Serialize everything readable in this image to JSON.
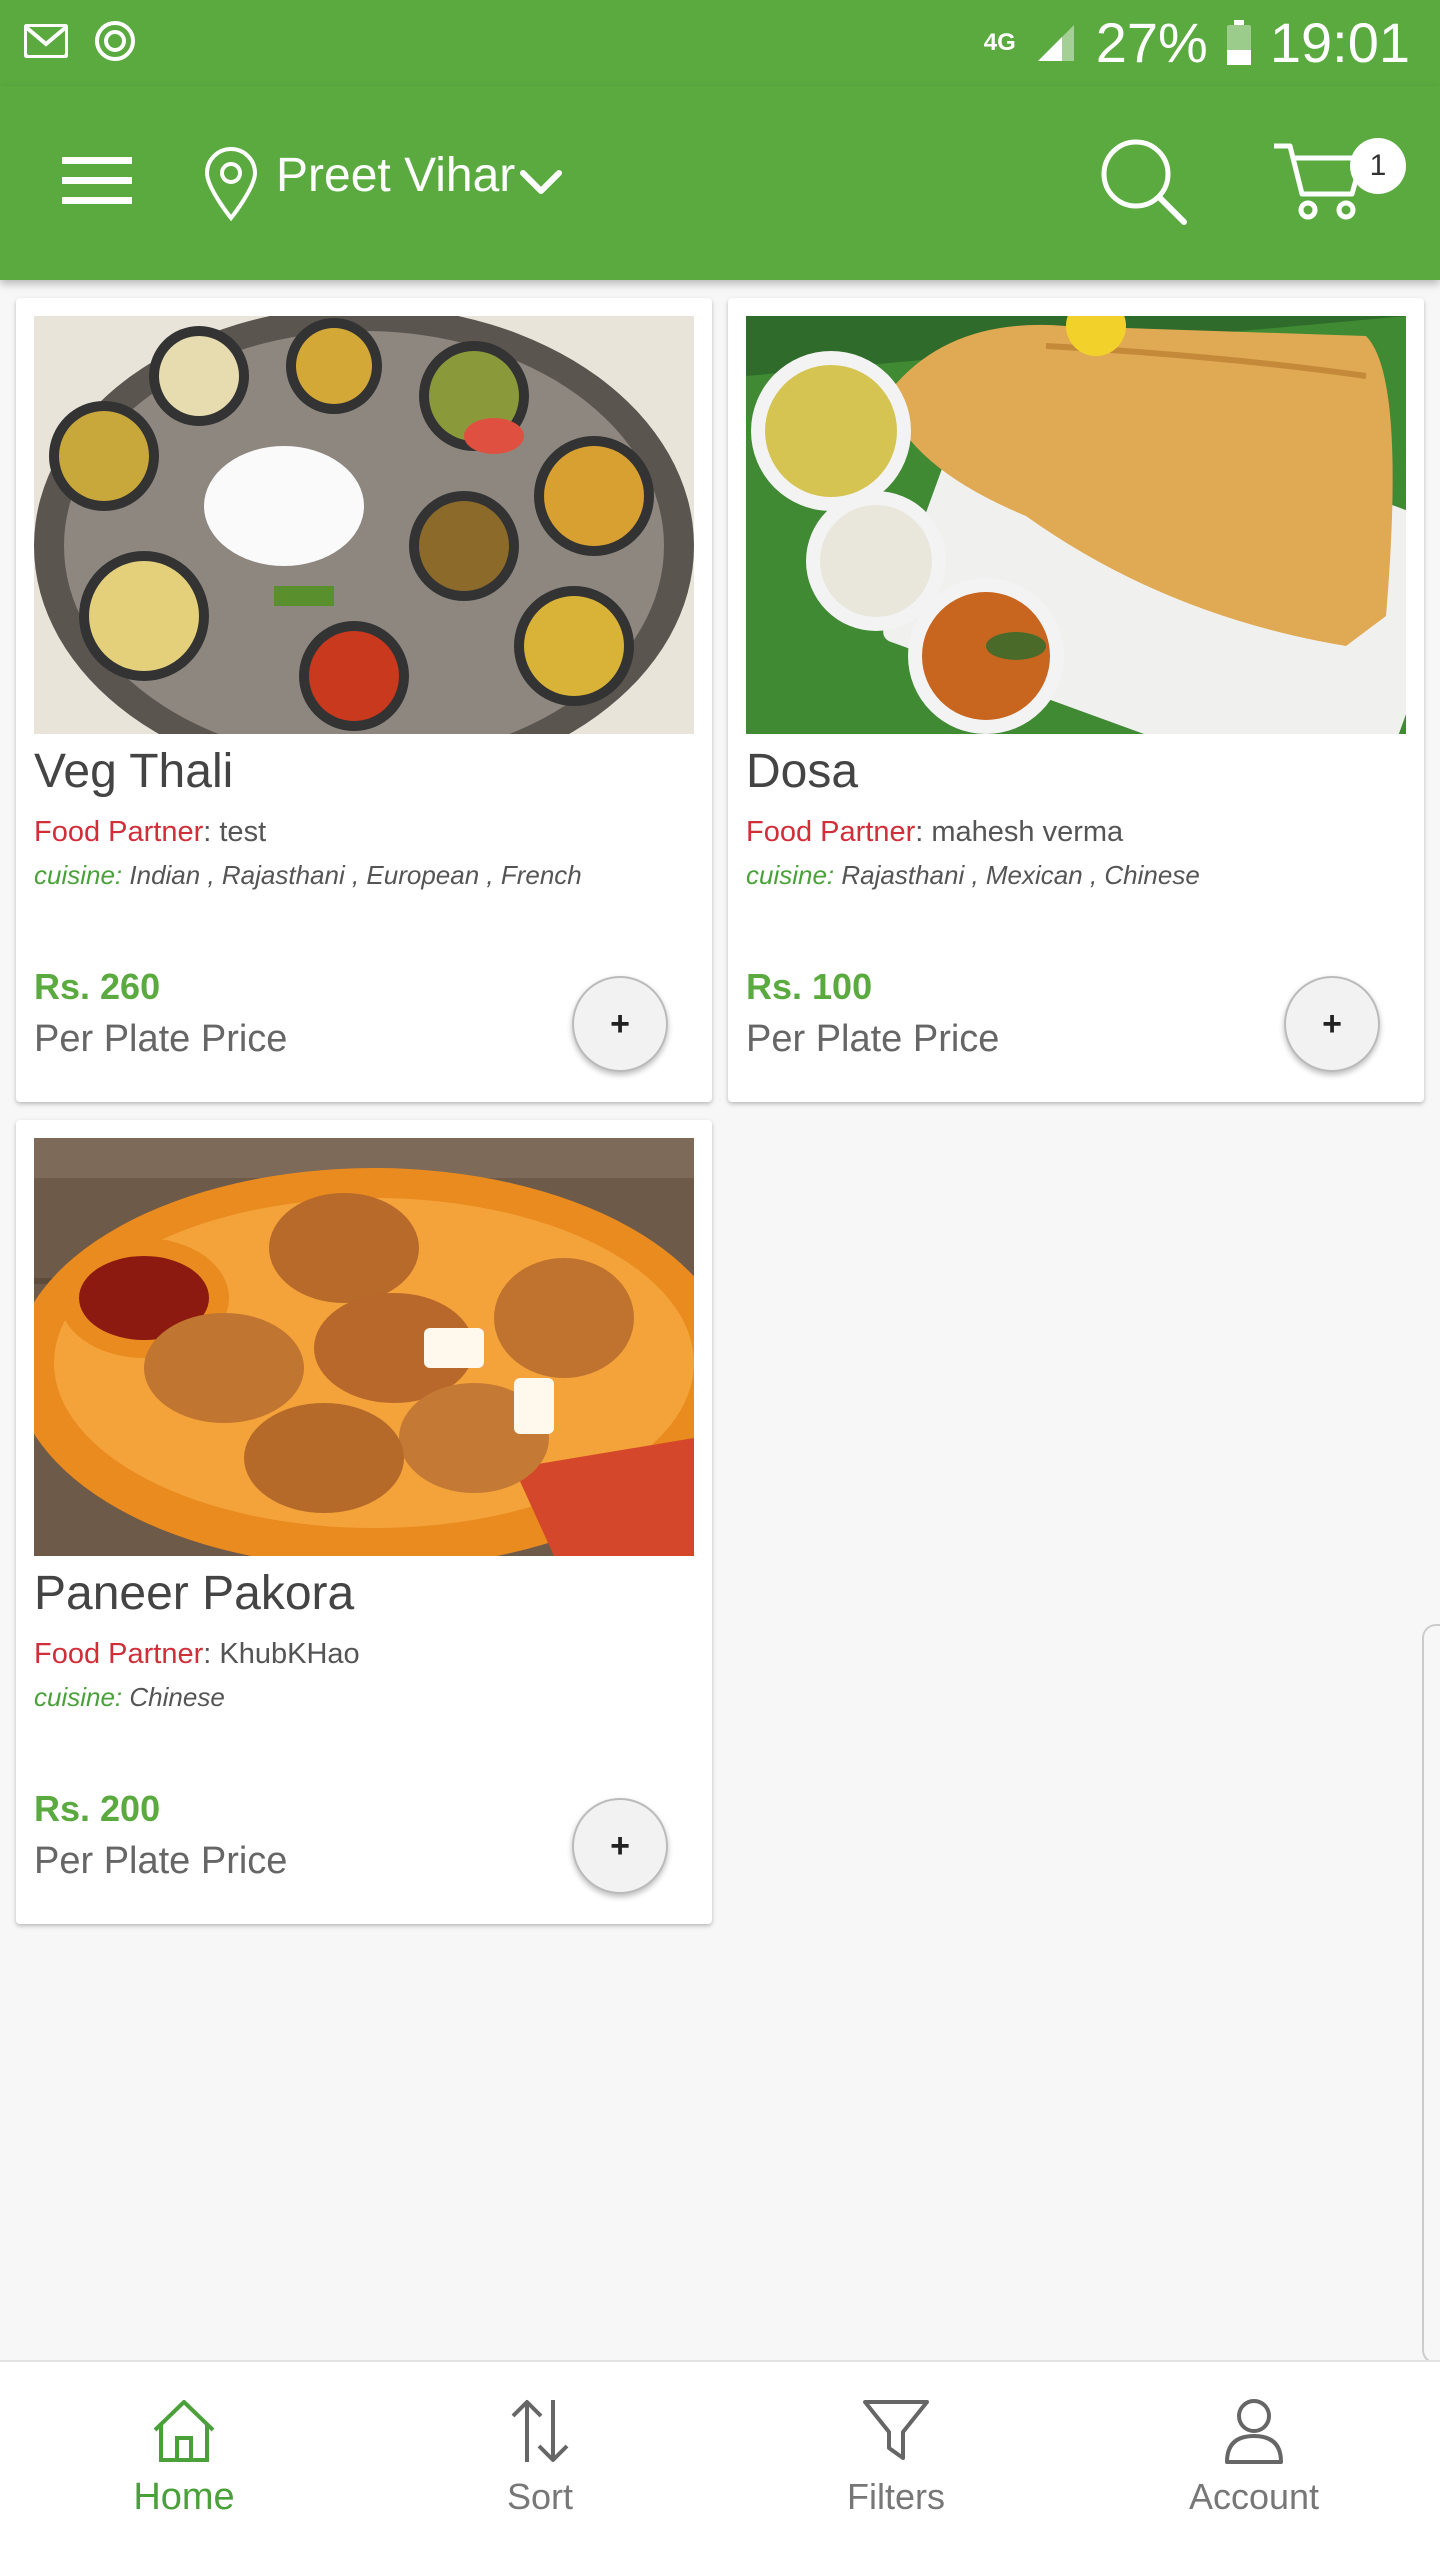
{
  "status_bar": {
    "network": "4G",
    "battery": "27%",
    "time": "19:01"
  },
  "app_bar": {
    "location": "Preet Vihar",
    "cart_count": "1"
  },
  "items": [
    {
      "title": "Veg Thali",
      "partner_label": "Food Partner",
      "partner": ": test",
      "cuisine_label": "cuisine:",
      "cuisine": " Indian , Rajasthani , European , French",
      "price": "Rs. 260",
      "price_note": "Per Plate Price",
      "add_label": "+"
    },
    {
      "title": "Dosa",
      "partner_label": "Food Partner",
      "partner": ": mahesh verma",
      "cuisine_label": "cuisine:",
      "cuisine": " Rajasthani , Mexican , Chinese",
      "price": "Rs. 100",
      "price_note": "Per Plate Price",
      "add_label": "+"
    },
    {
      "title": "Paneer Pakora",
      "partner_label": "Food Partner",
      "partner": ": KhubKHao",
      "cuisine_label": "cuisine:",
      "cuisine": " Chinese",
      "price": "Rs. 200",
      "price_note": "Per Plate Price",
      "add_label": "+"
    }
  ],
  "bottom_nav": [
    {
      "label": "Home",
      "icon": "home-icon",
      "active": true
    },
    {
      "label": "Sort",
      "icon": "sort-icon",
      "active": false
    },
    {
      "label": "Filters",
      "icon": "filter-icon",
      "active": false
    },
    {
      "label": "Account",
      "icon": "account-icon",
      "active": false
    }
  ],
  "colors": {
    "primary": "#5aaa40",
    "partner_label": "#d02f3a",
    "cuisine_label": "#4aa13a"
  }
}
